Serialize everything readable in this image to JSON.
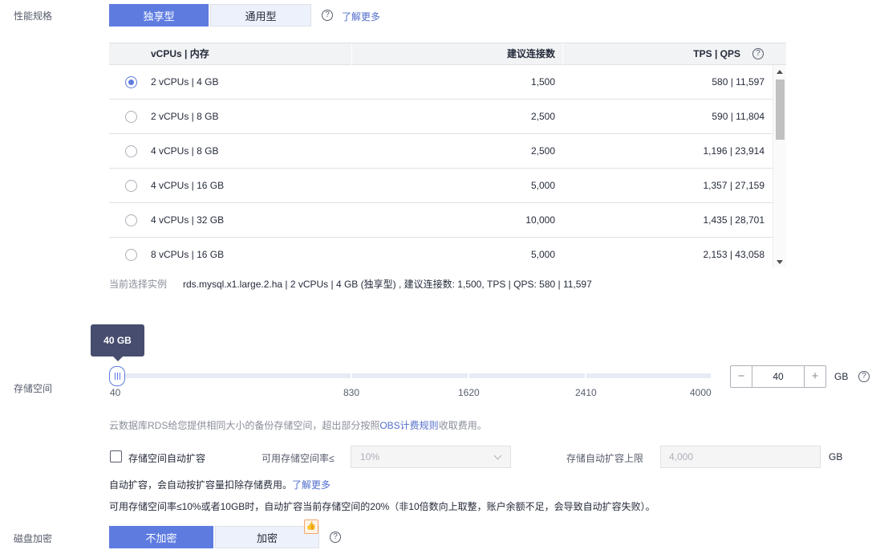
{
  "perf": {
    "label": "性能规格",
    "tabs": [
      {
        "label": "独享型",
        "active": true
      },
      {
        "label": "通用型",
        "active": false
      }
    ],
    "learn_more": "了解更多",
    "help": "?"
  },
  "table": {
    "headers": {
      "vcpu": "vCPUs | 内存",
      "conn": "建议连接数",
      "tps": "TPS | QPS"
    },
    "rows": [
      {
        "vcpu": "2 vCPUs | 4 GB",
        "conn": "1,500",
        "tps": "580 | 11,597",
        "selected": true
      },
      {
        "vcpu": "2 vCPUs | 8 GB",
        "conn": "2,500",
        "tps": "590 | 11,804",
        "selected": false
      },
      {
        "vcpu": "4 vCPUs | 8 GB",
        "conn": "2,500",
        "tps": "1,196 | 23,914",
        "selected": false
      },
      {
        "vcpu": "4 vCPUs | 16 GB",
        "conn": "5,000",
        "tps": "1,357 | 27,159",
        "selected": false
      },
      {
        "vcpu": "4 vCPUs | 32 GB",
        "conn": "10,000",
        "tps": "1,435 | 28,701",
        "selected": false
      },
      {
        "vcpu": "8 vCPUs | 16 GB",
        "conn": "5,000",
        "tps": "2,153 | 43,058",
        "selected": false
      }
    ]
  },
  "current": {
    "label": "当前选择实例",
    "value": "rds.mysql.x1.large.2.ha | 2 vCPUs | 4 GB (独享型) , 建议连接数: 1,500, TPS | QPS: 580 | 11,597"
  },
  "storage": {
    "label": "存储空间",
    "tooltip": "40 GB",
    "ticks": [
      "40",
      "830",
      "1620",
      "2410",
      "4000"
    ],
    "value": "40",
    "unit": "GB",
    "minus": "−",
    "plus": "+",
    "note_prefix": "云数据库RDS给您提供相同大小的备份存储空间，超出部分按照",
    "note_link": "OBS计费规则",
    "note_suffix": "收取费用。"
  },
  "autoscale": {
    "checkbox_label": "存储空间自动扩容",
    "rate_label": "可用存储空间率≤",
    "rate_value": "10%",
    "limit_label": "存储自动扩容上限",
    "limit_value": "4,000",
    "limit_unit": "GB",
    "info_line1": "自动扩容，会自动按扩容量扣除存储费用。",
    "info_link": "了解更多",
    "info_line2": "可用存储空间率≤10%或者10GB时，自动扩容当前存储空间的20%（非10倍数向上取整，账户余额不足，会导致自动扩容失败）。"
  },
  "encrypt": {
    "label": "磁盘加密",
    "tabs": [
      {
        "label": "不加密",
        "active": true
      },
      {
        "label": "加密",
        "active": false
      }
    ],
    "badge": "👍"
  }
}
